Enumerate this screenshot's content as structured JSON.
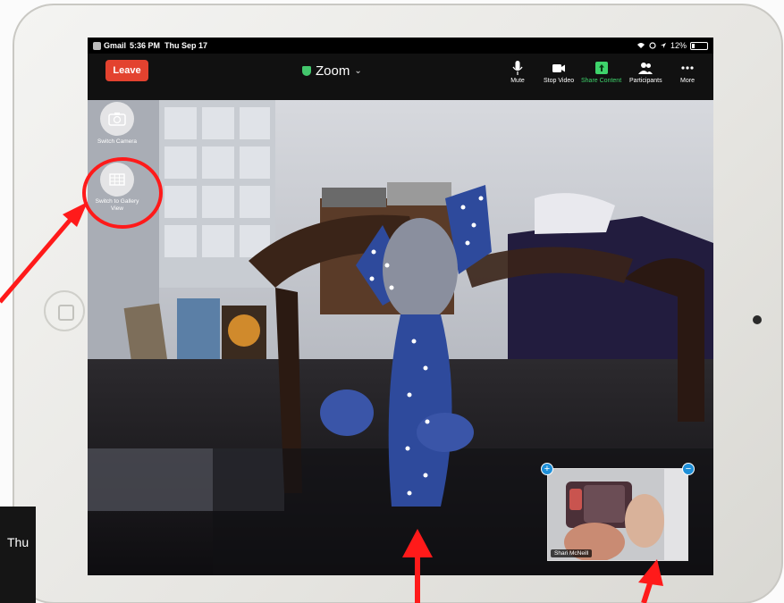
{
  "status_bar": {
    "app": "Gmail",
    "time": "5:36 PM",
    "date": "Thu Sep 17",
    "battery": "12%"
  },
  "toolbar": {
    "leave_label": "Leave",
    "meeting_title": "Zoom",
    "items": [
      {
        "label": "Mute",
        "icon": "microphone-icon"
      },
      {
        "label": "Stop Video",
        "icon": "video-camera-icon"
      },
      {
        "label": "Share Content",
        "icon": "share-icon"
      },
      {
        "label": "Participants",
        "icon": "participants-icon"
      },
      {
        "label": "More",
        "icon": "ellipsis-icon"
      }
    ]
  },
  "side_controls": {
    "switch_camera_label": "Switch Camera",
    "gallery_view_label": "Switch to Gallery View"
  },
  "self_view": {
    "name": "Shari McNeill"
  },
  "inset": {
    "text": "Thu"
  },
  "colors": {
    "leave": "#e3422f",
    "share": "#3ed36b",
    "annotation": "#ff1a1a",
    "pip_button": "#1e8fd8"
  }
}
